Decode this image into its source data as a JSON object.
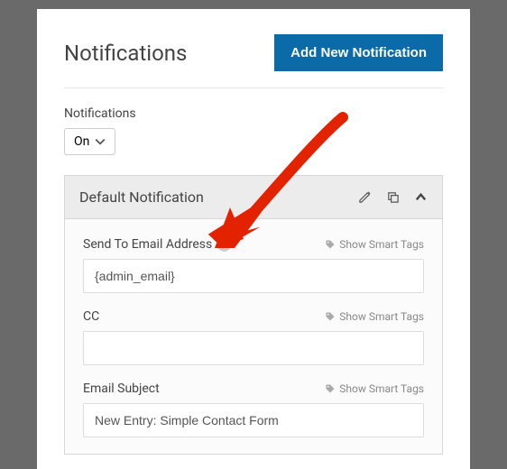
{
  "header": {
    "title": "Notifications",
    "add_button": "Add New Notification"
  },
  "toggle": {
    "label": "Notifications",
    "value": "On"
  },
  "notification": {
    "title": "Default Notification",
    "smart_tags_label": "Show Smart Tags",
    "fields": {
      "send_to": {
        "label": "Send To Email Address",
        "value": "{admin_email}"
      },
      "cc": {
        "label": "CC",
        "value": ""
      },
      "subject": {
        "label": "Email Subject",
        "value": "New Entry: Simple Contact Form"
      }
    }
  }
}
